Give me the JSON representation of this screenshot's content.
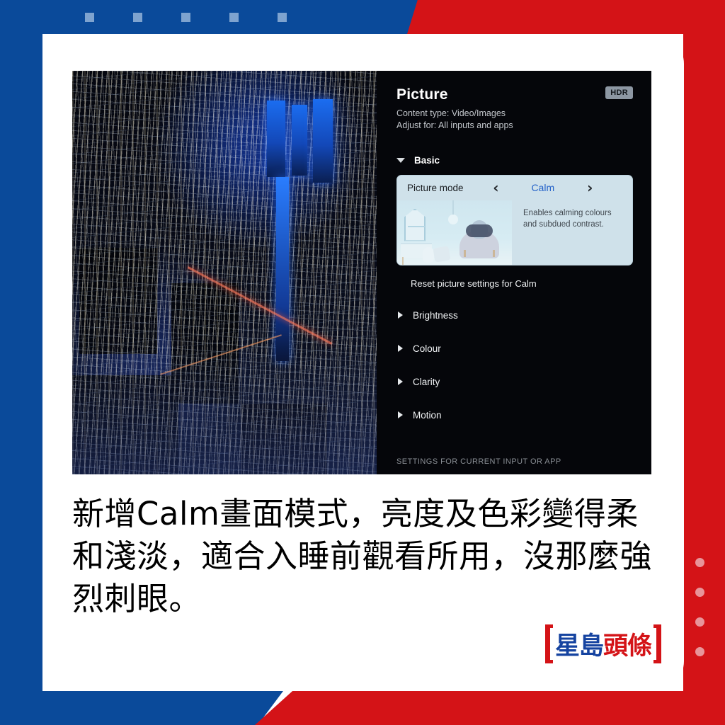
{
  "background": {
    "blue": "#0a4a9a",
    "red": "#d41317",
    "top_squares_color": "#7ea3cf",
    "top_squares_count": 5,
    "side_dots_color": "#e8959a",
    "side_dots_count": 4
  },
  "tv": {
    "photo": {
      "name": "night-city-skyline-photo",
      "description": "Aerial night cityscape with illuminated skyscrapers"
    },
    "panel": {
      "title": "Picture",
      "hdr_badge": "HDR",
      "content_type": "Content type: Video/Images",
      "adjust_for": "Adjust for: All inputs and apps",
      "section": "Basic",
      "picture_mode": {
        "label": "Picture mode",
        "value": "Calm",
        "value_color": "#2563c9",
        "prev_icon": "‹",
        "next_icon": "›",
        "description": "Enables calming colours and subdued contrast.",
        "thumbnail": "pastel-nursery-room-thumbnail"
      },
      "reset": "Reset picture settings for Calm",
      "menu": [
        {
          "label": "Brightness"
        },
        {
          "label": "Colour"
        },
        {
          "label": "Clarity"
        },
        {
          "label": "Motion"
        }
      ],
      "footer": "SETTINGS FOR CURRENT INPUT OR APP"
    }
  },
  "caption": {
    "text": "新增Calm畫面模式，亮度及色彩變得柔和淺淡，適合入睡前觀看所用，沒那麼強烈刺眼。"
  },
  "logo": {
    "part_blue": "星島",
    "part_red": "頭條",
    "blue_color": "#1543a0",
    "red_color": "#d41317"
  }
}
